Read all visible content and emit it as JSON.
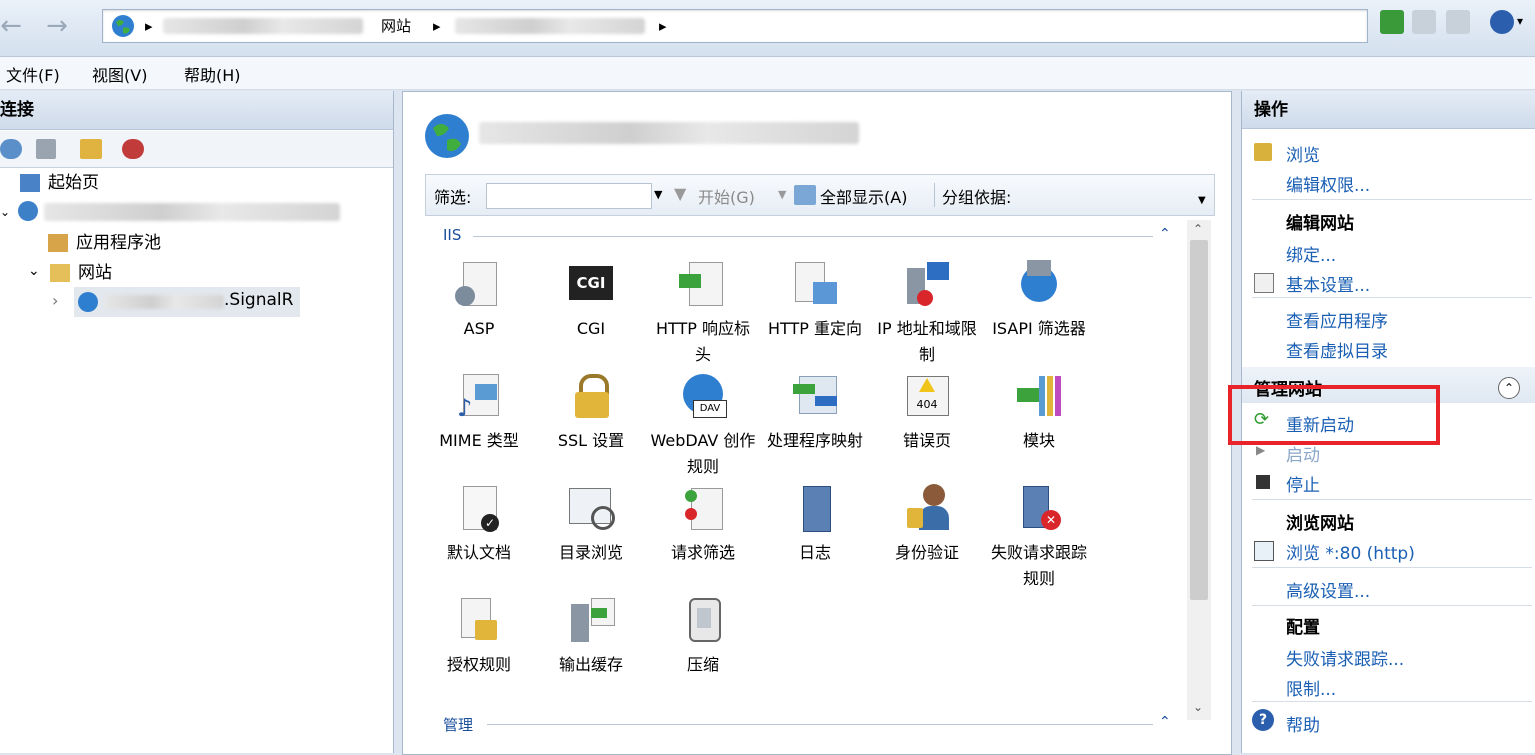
{
  "address": {
    "crumb_sites": "网站"
  },
  "menu": {
    "file": "文件(F)",
    "view": "视图(V)",
    "help": "帮助(H)"
  },
  "left": {
    "header": "连接",
    "tree": {
      "start_page": "起始页",
      "app_pools": "应用程序池",
      "sites": "网站",
      "site_suffix": ".SignalR"
    }
  },
  "center": {
    "filter_label": "筛选:",
    "start_label": "开始(G)",
    "show_all_label": "全部显示(A)",
    "group_by_label": "分组依据:",
    "section_iis": "IIS",
    "section_manage": "管理",
    "features": [
      {
        "label": "ASP"
      },
      {
        "label": "CGI"
      },
      {
        "label": "HTTP 响应标头"
      },
      {
        "label": "HTTP 重定向"
      },
      {
        "label": "IP 地址和域限制"
      },
      {
        "label": "ISAPI 筛选器"
      },
      {
        "label": "MIME 类型"
      },
      {
        "label": "SSL 设置"
      },
      {
        "label": "WebDAV 创作规则"
      },
      {
        "label": "处理程序映射"
      },
      {
        "label": "错误页"
      },
      {
        "label": "模块"
      },
      {
        "label": "默认文档"
      },
      {
        "label": "目录浏览"
      },
      {
        "label": "请求筛选"
      },
      {
        "label": "日志"
      },
      {
        "label": "身份验证"
      },
      {
        "label": "失败请求跟踪规则"
      },
      {
        "label": "授权规则"
      },
      {
        "label": "输出缓存"
      },
      {
        "label": "压缩"
      }
    ],
    "cgi_badge": "CGI",
    "err_badge": "404",
    "dav_badge": "DAV"
  },
  "right": {
    "header": "操作",
    "browse": "浏览",
    "edit_perms": "编辑权限...",
    "edit_site_head": "编辑网站",
    "bindings": "绑定...",
    "basic_settings": "基本设置...",
    "view_apps": "查看应用程序",
    "view_vdirs": "查看虚拟目录",
    "manage_head": "管理网站",
    "restart": "重新启动",
    "start": "启动",
    "stop": "停止",
    "browse_site_head": "浏览网站",
    "browse_80": "浏览 *:80 (http)",
    "advanced": "高级设置...",
    "config_head": "配置",
    "failed_tracing": "失败请求跟踪...",
    "limits": "限制...",
    "help": "帮助"
  },
  "colors": {
    "accent_link": "#1a5fb4",
    "highlight_box": "#e8232a"
  }
}
